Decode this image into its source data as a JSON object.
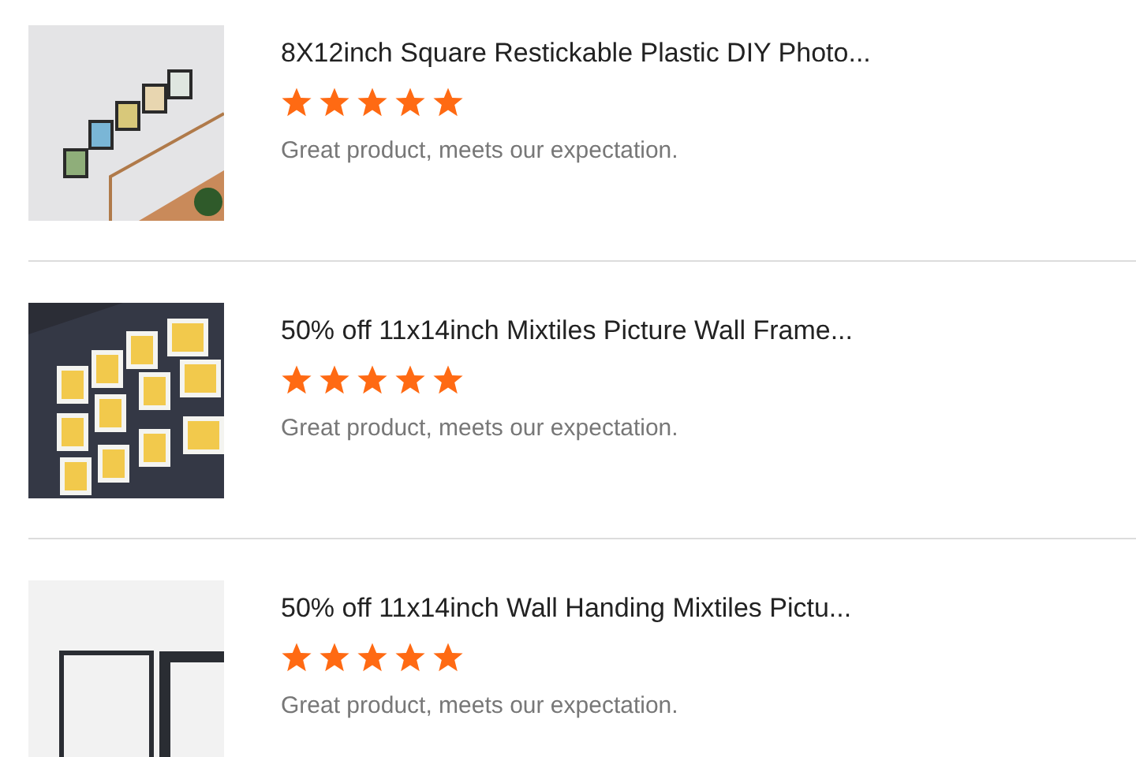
{
  "reviews": [
    {
      "title": "8X12inch Square Restickable Plastic DIY Photo...",
      "stars": 5,
      "comment": "Great product, meets our expectation."
    },
    {
      "title": "50% off 11x14inch Mixtiles Picture Wall Frame...",
      "stars": 5,
      "comment": "Great product, meets our expectation."
    },
    {
      "title": "50% off 11x14inch Wall Handing Mixtiles Pictu...",
      "stars": 5,
      "comment": "Great product, meets our expectation."
    }
  ]
}
